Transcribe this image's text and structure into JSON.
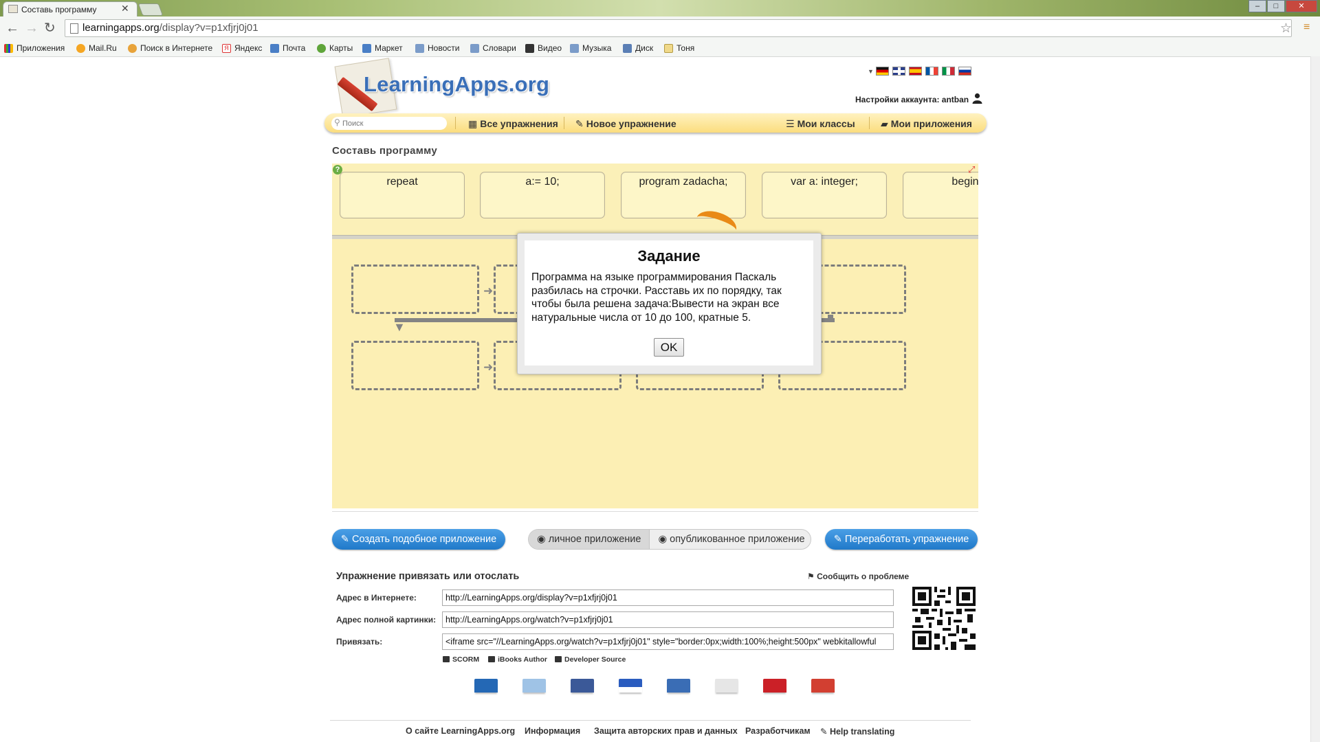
{
  "browser": {
    "tab_title": "Составь программу",
    "url_host": "learningapps.org",
    "url_path": "/display?v=p1xfjrj0j01",
    "bookmarks": [
      "Приложения",
      "Mail.Ru",
      "Поиск в Интернете",
      "Яндекс",
      "Почта",
      "Карты",
      "Маркет",
      "Новости",
      "Словари",
      "Видео",
      "Музыка",
      "Диск",
      "Тоня"
    ]
  },
  "site": {
    "logo": "LearningApps.org",
    "account_label": "Настройки аккаунта: antban",
    "search_placeholder": "Поиск",
    "nav": {
      "all": "Все упражнения",
      "new": "Новое упражнение",
      "classes": "Мои классы",
      "apps": "Мои приложения"
    }
  },
  "page_title": "Составь программу",
  "cards": [
    "repeat",
    "a:= 10;",
    "program zadacha;",
    "var a: integer;",
    "begin"
  ],
  "dialog": {
    "title": "Задание",
    "text": "Программа на языке программирования Паскаль разбилась на строчки. Расставь их по порядку, так чтобы была решена задача:Вывести на экран все натуральные числа от 10 до 100, кратные 5.",
    "ok": "OK"
  },
  "actions": {
    "create_similar": "Создать подобное приложение",
    "private": "личное приложение",
    "published": "опубликованное приложение",
    "rework": "Переработать упражнение"
  },
  "embed": {
    "title": "Упражнение привязать или отослать",
    "report": "Сообщить о проблеме",
    "internet_label": "Адрес в Интернете:",
    "internet_value": "http://LearningApps.org/display?v=p1xfjrj0j01",
    "picture_label": "Адрес полной картинки:",
    "picture_value": "http://LearningApps.org/watch?v=p1xfjrj0j01",
    "embed_label": "Привязать:",
    "embed_value": "<iframe src=\"//LearningApps.org/watch?v=p1xfjrj0j01\" style=\"border:0px;width:100%;height:500px\" webkitallowful",
    "scorm": "SCORM",
    "ibooks": "iBooks Author",
    "devsource": "Developer Source"
  },
  "footer": {
    "about": "О сайте LearningApps.org",
    "info": "Информация",
    "privacy": "Защита авторских прав и данных",
    "developers": "Разработчикам",
    "translate": "Help translating"
  },
  "colors": {
    "brand_blue": "#3a6fb8",
    "nav_yellow": "#fbdd7e",
    "button_blue": "#2f8bdc",
    "app_background": "#fcefb4"
  }
}
